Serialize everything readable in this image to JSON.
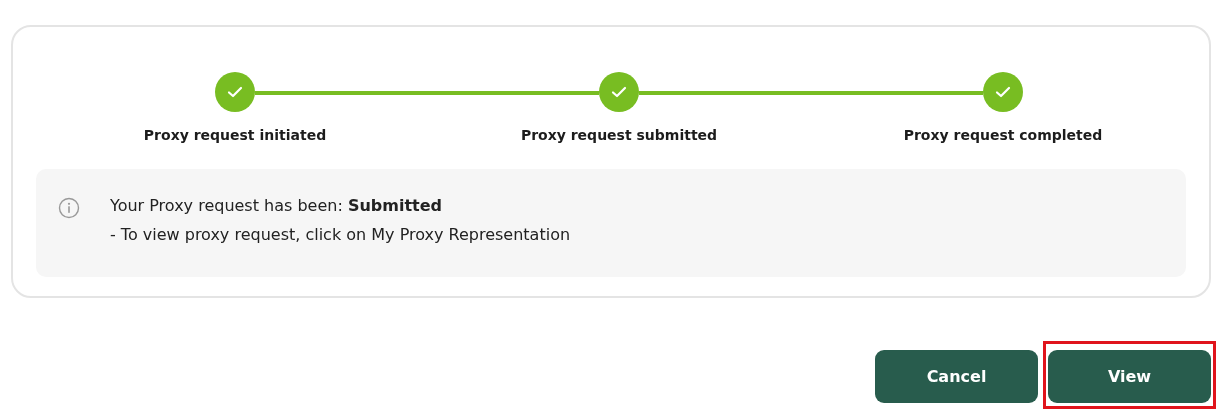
{
  "steps": [
    {
      "label": "Proxy request initiated",
      "completed": true
    },
    {
      "label": "Proxy request submitted",
      "completed": true
    },
    {
      "label": "Proxy request completed",
      "completed": true
    }
  ],
  "notice": {
    "lines": [
      "Your Proxy request has been: **Submitted**",
      "- To view proxy request, click on My Proxy Representation"
    ]
  },
  "buttons": [
    {
      "label": "Cancel",
      "highlighted": false
    },
    {
      "label": "View",
      "highlighted": true
    }
  ]
}
